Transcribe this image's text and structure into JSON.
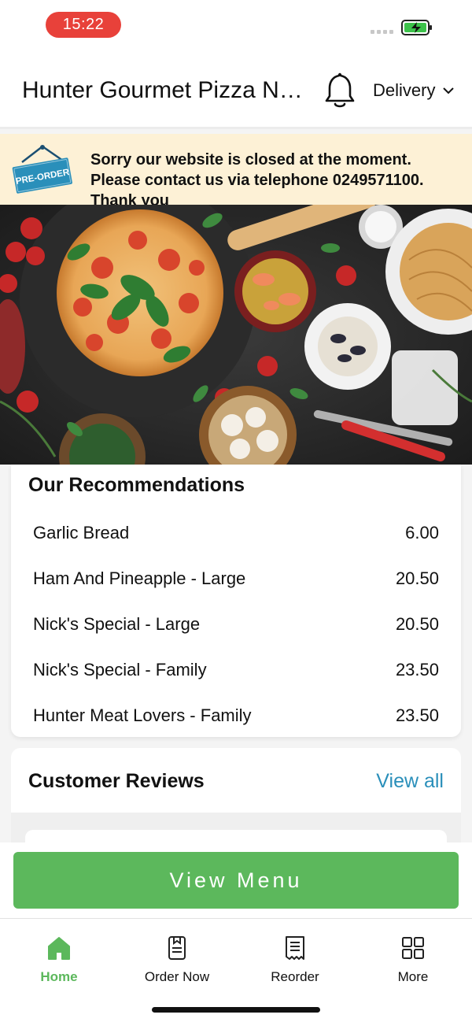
{
  "status_bar": {
    "time": "15:22"
  },
  "header": {
    "store_name": "Hunter Gourmet Pizza Newcastle",
    "order_mode": "Delivery"
  },
  "banner": {
    "badge": "PRE-ORDER",
    "message": "Sorry our website is closed at the moment. Please contact us via telephone 0249571100. Thank you"
  },
  "recommendations": {
    "title": "Our Recommendations",
    "items": [
      {
        "name": "Garlic Bread",
        "price": "6.00"
      },
      {
        "name": "Ham And Pineapple - Large",
        "price": "20.50"
      },
      {
        "name": "Nick's Special - Large",
        "price": "20.50"
      },
      {
        "name": "Nick's Special - Family",
        "price": "23.50"
      },
      {
        "name": "Hunter Meat Lovers - Family",
        "price": "23.50"
      }
    ]
  },
  "reviews": {
    "title": "Customer Reviews",
    "view_all": "View all"
  },
  "cta": {
    "label": "View Menu"
  },
  "nav": {
    "items": [
      {
        "label": "Home",
        "icon": "home-icon"
      },
      {
        "label": "Order Now",
        "icon": "order-now-icon"
      },
      {
        "label": "Reorder",
        "icon": "reorder-icon"
      },
      {
        "label": "More",
        "icon": "more-icon"
      }
    ]
  },
  "colors": {
    "accent_green": "#5cb85c",
    "link_blue": "#2a8fba",
    "banner_bg": "#fdf1d6",
    "time_pill": "#e8413a"
  }
}
